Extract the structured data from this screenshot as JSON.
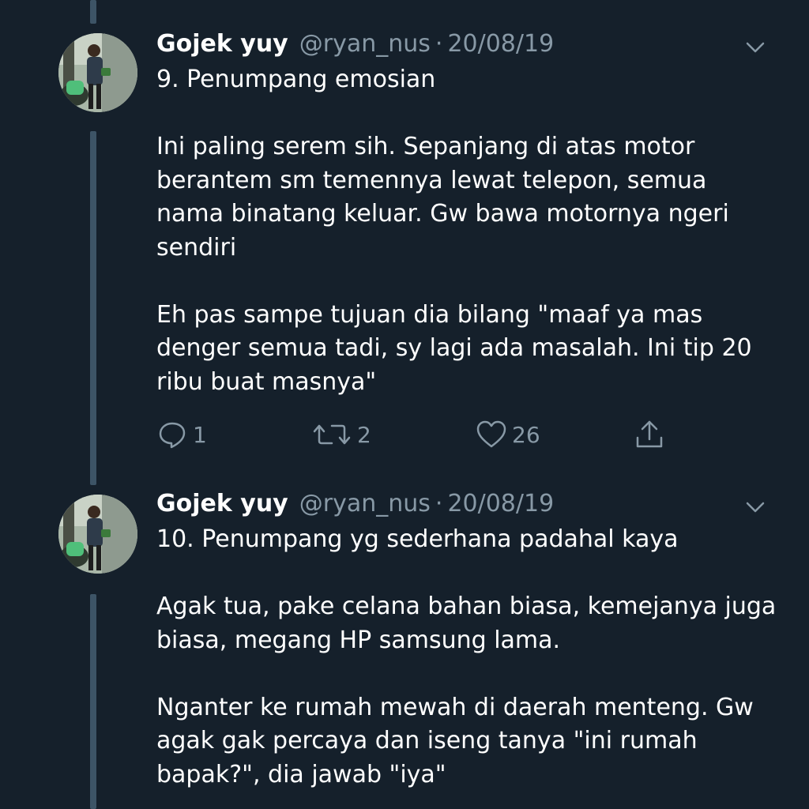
{
  "tweets": [
    {
      "name": "Gojek yuy",
      "handle": "@ryan_nus",
      "separator": "·",
      "date": "20/08/19",
      "text": "9. Penumpang emosian\n\nIni paling serem sih. Sepanjang di atas motor berantem sm temennya lewat telepon, semua nama binatang keluar. Gw bawa motornya ngeri sendiri\n\nEh pas sampe tujuan dia bilang \"maaf ya mas denger semua tadi, sy lagi ada masalah. Ini tip 20 ribu buat masnya\"",
      "replies": "1",
      "retweets": "2",
      "likes": "26"
    },
    {
      "name": "Gojek yuy",
      "handle": "@ryan_nus",
      "separator": "·",
      "date": "20/08/19",
      "text": "10. Penumpang yg sederhana padahal kaya\n\nAgak tua, pake celana bahan biasa, kemejanya juga biasa, megang HP samsung lama.\n\nNganter ke rumah mewah di daerah menteng. Gw agak gak percaya dan iseng tanya \"ini rumah bapak?\", dia jawab \"iya\""
    }
  ],
  "icons": {
    "reply": "reply-icon",
    "retweet": "retweet-icon",
    "like": "heart-icon",
    "share": "share-icon",
    "caret": "chevron-down-icon"
  },
  "colors": {
    "background": "#15202b",
    "secondary_text": "#8899a6",
    "thread_line": "#3d5466"
  }
}
